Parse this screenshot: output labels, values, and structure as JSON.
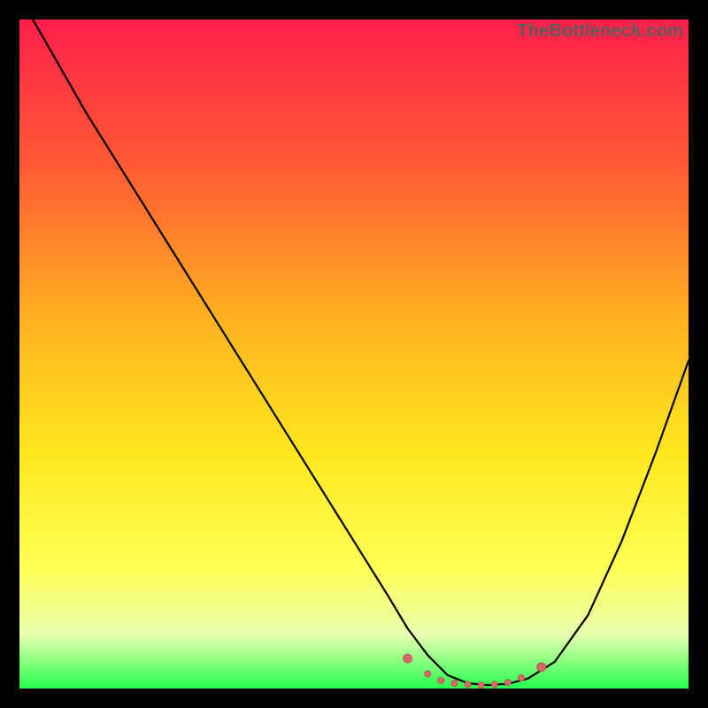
{
  "watermark": "TheBottleneck.com",
  "colors": {
    "background": "#000000",
    "gradient_top": "#ff1f4b",
    "gradient_mid1": "#ff6a2a",
    "gradient_mid2": "#ffd21f",
    "gradient_mid3": "#ffff4a",
    "gradient_mid4": "#eeffa0",
    "gradient_bottom": "#2eff5a",
    "curve": "#000000",
    "marker_fill": "#d46a6a",
    "marker_stroke": "#b94e4e"
  },
  "chart_data": {
    "type": "line",
    "title": "",
    "xlabel": "",
    "ylabel": "",
    "xlim": [
      0,
      100
    ],
    "ylim": [
      0,
      100
    ],
    "series": [
      {
        "name": "bottleneck-curve",
        "x": [
          2,
          6,
          10,
          15,
          20,
          25,
          30,
          35,
          40,
          45,
          50,
          55,
          58,
          61,
          64,
          67,
          70,
          73,
          76,
          80,
          85,
          90,
          95,
          100
        ],
        "y": [
          100,
          93,
          86,
          78,
          70,
          62,
          54,
          46,
          38,
          30,
          22,
          14,
          9,
          5,
          2,
          0.8,
          0.5,
          0.7,
          1.5,
          4,
          11,
          22,
          35,
          49
        ]
      }
    ],
    "markers": {
      "name": "optimum-band",
      "x": [
        58,
        61,
        63,
        65,
        67,
        69,
        71,
        73,
        75,
        78
      ],
      "y": [
        4.5,
        2.2,
        1.2,
        0.8,
        0.6,
        0.5,
        0.6,
        0.9,
        1.6,
        3.2
      ]
    }
  }
}
